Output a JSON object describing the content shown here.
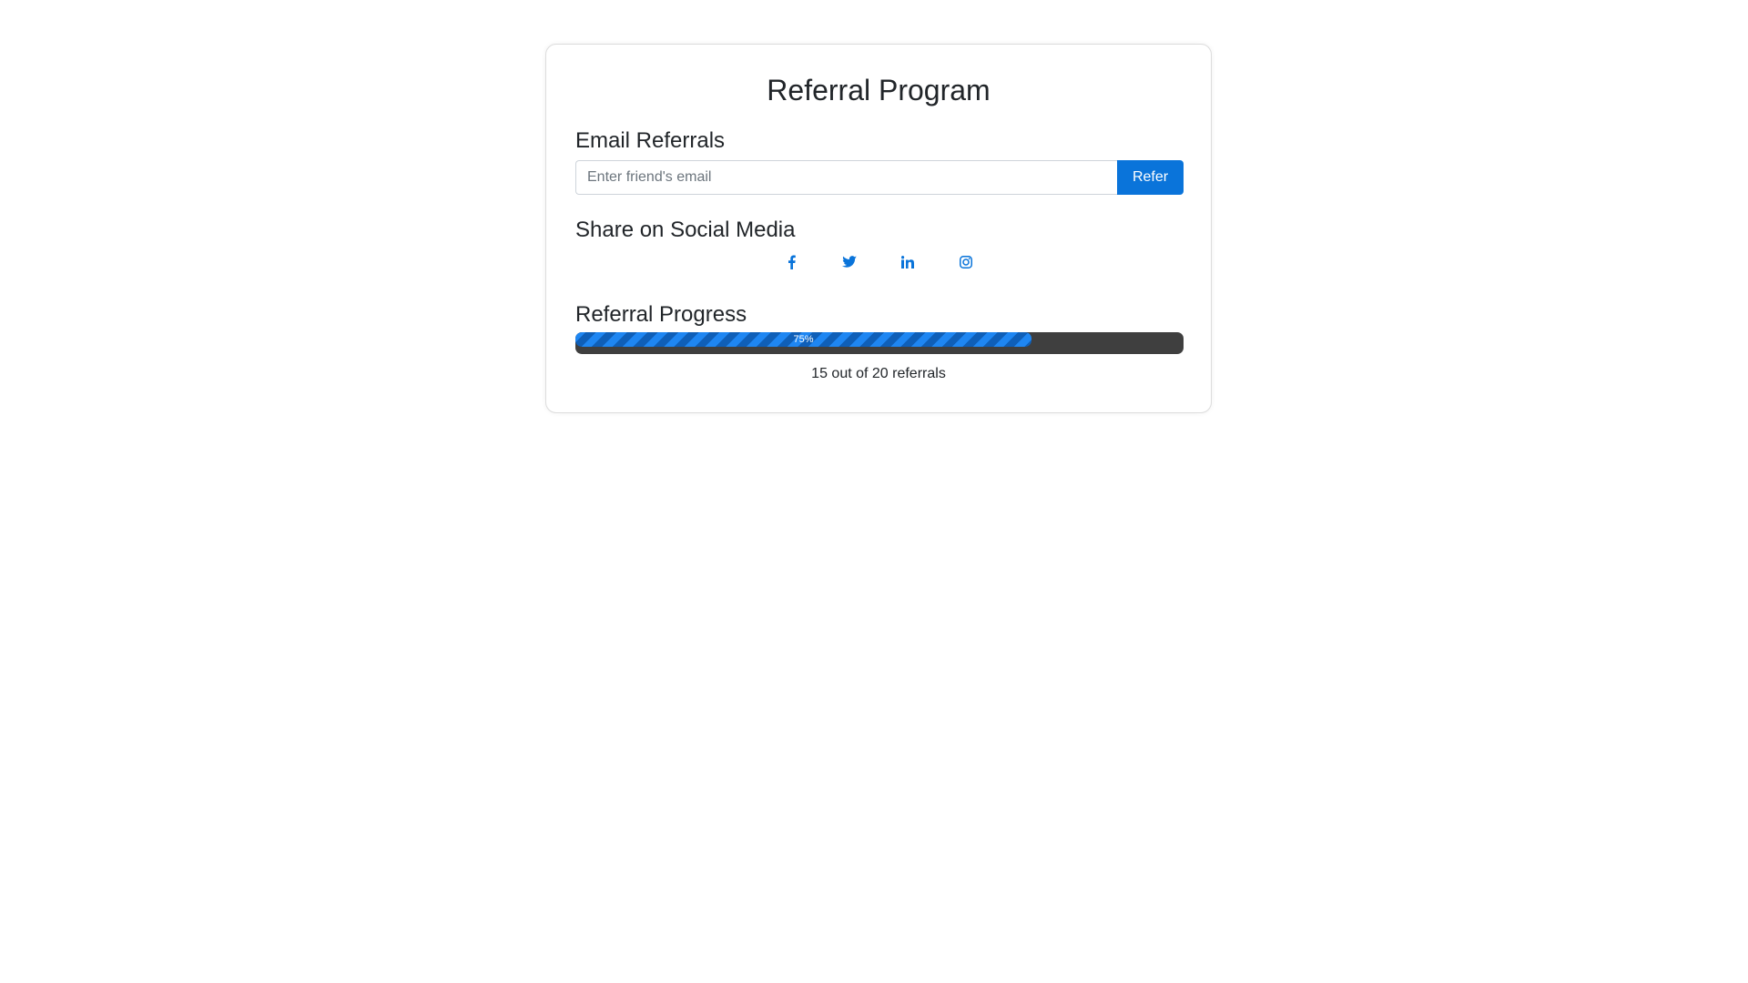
{
  "page": {
    "title": "Referral Program"
  },
  "email_section": {
    "heading": "Email Referrals",
    "input_placeholder": "Enter friend's email",
    "input_value": "",
    "button_label": "Refer"
  },
  "social_section": {
    "heading": "Share on Social Media",
    "icons": [
      "facebook-icon",
      "twitter-icon",
      "linkedin-icon",
      "instagram-icon"
    ]
  },
  "progress_section": {
    "heading": "Referral Progress",
    "percent": 75,
    "percent_label": "75%",
    "caption": "15 out of 20 referrals",
    "completed": 15,
    "goal": 20
  },
  "colors": {
    "accent": "#0a74da",
    "progress_fill": "#1a82f0",
    "progress_track": "#3f3f3f"
  }
}
